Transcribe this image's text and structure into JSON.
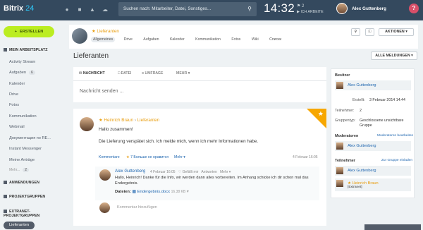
{
  "topbar": {
    "logo_name": "Bitrix",
    "logo_num": "24",
    "search_placeholder": "Suchen nach: Mitarbeiter, Datei, Sonstiges...",
    "clock": "14:32",
    "tasks_count": "2",
    "work_status": "ICH ARBEITE",
    "user_name": "Alex Guttenberg",
    "help": "?"
  },
  "sidebar": {
    "create_label": "ERSTELLEN",
    "workplace_title": "MEIN ARBEITSPLATZ",
    "items": [
      {
        "label": "Activity Stream",
        "badge": ""
      },
      {
        "label": "Aufgaben",
        "badge": "6"
      },
      {
        "label": "Kalender",
        "badge": ""
      },
      {
        "label": "Drive",
        "badge": ""
      },
      {
        "label": "Fotos",
        "badge": ""
      },
      {
        "label": "Kommunikation",
        "badge": ""
      },
      {
        "label": "Webmail",
        "badge": ""
      },
      {
        "label": "Документация по RE...",
        "badge": ""
      },
      {
        "label": "Instant Messenger",
        "badge": ""
      },
      {
        "label": "Meine Anträge",
        "badge": ""
      },
      {
        "label": "Mehr...",
        "badge": "2"
      }
    ],
    "sections": [
      "ANWENDUNGEN",
      "PROJEKTGRUPPEN",
      "EXTRANET-PROJEKTGRUPPEN"
    ],
    "active_item": "Lieferanten"
  },
  "group": {
    "name": "Lieferanten",
    "tabs": [
      "Allgemeines",
      "Drive",
      "Aufgaben",
      "Kalender",
      "Kommunikation",
      "Fotos",
      "Wiki",
      "Списки"
    ],
    "actions_label": "AKTIONEN"
  },
  "page": {
    "title": "Lieferanten",
    "filter_label": "ALLE MELDUNGEN"
  },
  "composer": {
    "tabs": [
      "NACHRICHT",
      "DATEI",
      "UMFRAGE",
      "MEHR"
    ],
    "placeholder": "Nachricht senden ..."
  },
  "post": {
    "author": "Heinrich Braun",
    "group": "Lieferanten",
    "greeting": "Hallo zusammen!",
    "body": "Die Lieferung verspätet sich. Ich melde mich, wenn ich mehr Informationen habe.",
    "comments_link": "Kommentare",
    "likes": "7 Больше не нравится",
    "more": "Mehr",
    "date": "4 Februar 16:05",
    "comment": {
      "author": "Alex Guttenberg",
      "date": "4 Februar 16:05",
      "like": "Gefällt mir",
      "reply": "Antworten",
      "more": "Mehr",
      "text": "Hallo, Heinrich! Danke für die Info, wir werden dann alles vorbereiten. Im Anhang schicke ich dir schon mal das Endergebnis.",
      "files_label": "Dateien:",
      "file_name": "Endergebnis.docx",
      "file_size": "16.38 KB"
    },
    "add_comment": "Kommentar hinzufügen"
  },
  "right_panel": {
    "owner_title": "Besitzer",
    "owner_name": "Alex Guttenberg",
    "created_label": "Erstellt:",
    "created_value": "3 Februar 2014 14:44",
    "members_label": "Teilnehmer:",
    "members_value": "2",
    "type_label": "Gruppentyp:",
    "type_value": "Geschlossene unsichtbare Gruppe",
    "moderators_title": "Moderatoren",
    "moderators_link": "Moderatoren bearbeiten",
    "moderator_name": "Alex Guttenberg",
    "participants_title": "Teilnehmer",
    "participants_link": "Zur Gruppe einladen",
    "participant1": "Alex Guttenberg",
    "participant2": "Heinrich Braun",
    "participant2_note": "[Extranet]"
  }
}
